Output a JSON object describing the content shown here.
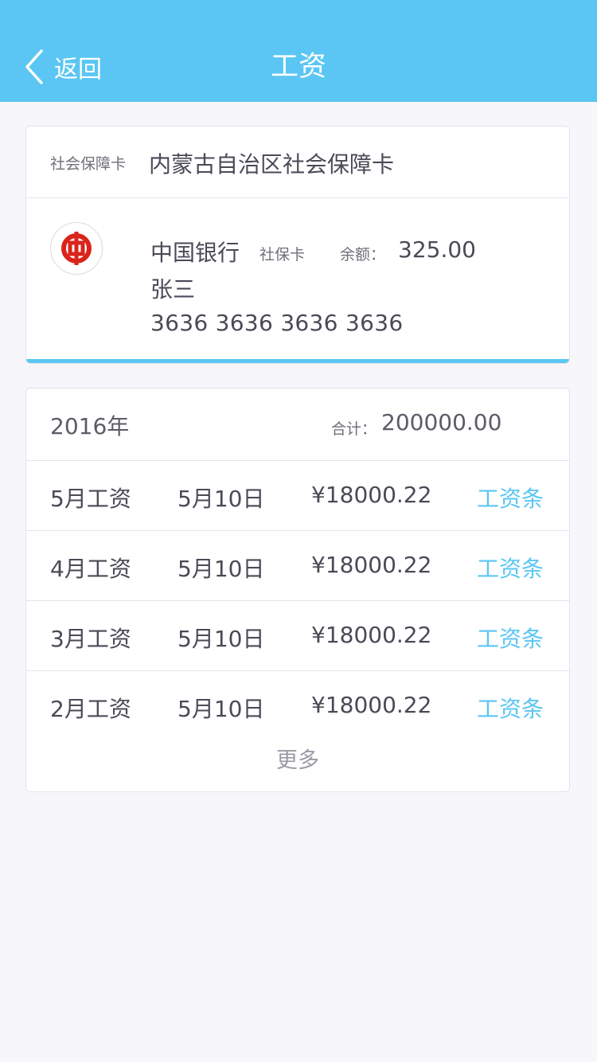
{
  "nav": {
    "back_label": "返回",
    "title": "工资"
  },
  "social_card": {
    "label": "社会保障卡",
    "name": "内蒙古自治区社会保障卡"
  },
  "bank": {
    "logo_icon": "bank-of-china-logo-icon",
    "name": "中国银行",
    "card_type": "社保卡",
    "balance_label": "余额：",
    "balance": "325.00",
    "holder": "张三",
    "card_number": "3636 3636 3636 3636"
  },
  "salary": {
    "year": "2016年",
    "total_label": "合计：",
    "total": "200000.00",
    "rows": [
      {
        "month": "5月工资",
        "date": "5月10日",
        "amount": "¥18000.22",
        "slip": "工资条"
      },
      {
        "month": "4月工资",
        "date": "5月10日",
        "amount": "¥18000.22",
        "slip": "工资条"
      },
      {
        "month": "3月工资",
        "date": "5月10日",
        "amount": "¥18000.22",
        "slip": "工资条"
      },
      {
        "month": "2月工资",
        "date": "5月10日",
        "amount": "¥18000.22",
        "slip": "工资条"
      }
    ],
    "more_label": "更多"
  },
  "colors": {
    "accent": "#5bc6f3",
    "bank_red": "#d9241b"
  }
}
